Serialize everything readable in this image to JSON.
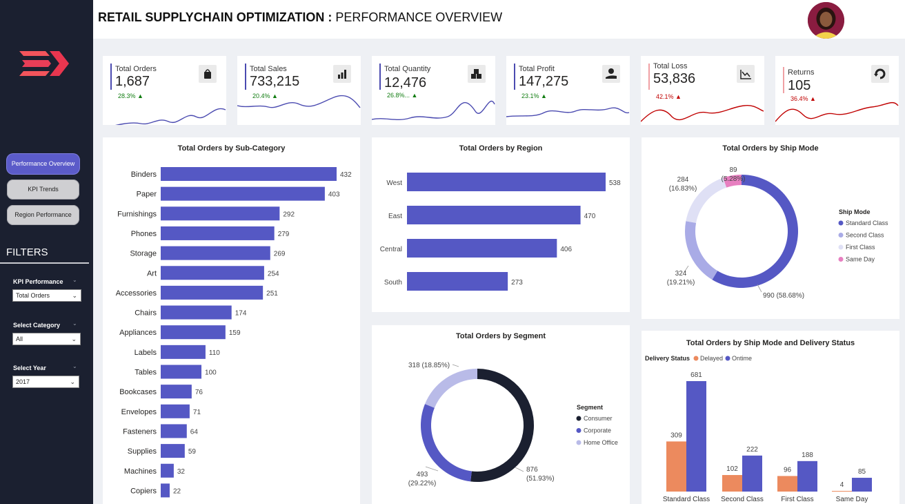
{
  "header": {
    "title_bold": "RETAIL SUPPLYCHAIN OPTIMIZATION :",
    "title_rest": "PERFORMANCE OVERVIEW"
  },
  "nav": {
    "items": [
      {
        "label": "Performance Overview",
        "active": true
      },
      {
        "label": "KPI Trends",
        "active": false
      },
      {
        "label": "Region Performance",
        "active": false
      }
    ]
  },
  "filters": {
    "title": "FILTERS",
    "kpi_performance": {
      "label": "KPI Performance",
      "value": "Total Orders"
    },
    "category": {
      "label": "Select Category",
      "value": "All"
    },
    "year": {
      "label": "Select Year",
      "value": "2017"
    }
  },
  "kpis": [
    {
      "label": "Total Orders",
      "value": "1,687",
      "delta": "28.3%",
      "trend": "up",
      "icon": "shopping-bag-icon",
      "color": "#4a4ab0"
    },
    {
      "label": "Total Sales",
      "value": "733,215",
      "delta": "20.4%",
      "trend": "up",
      "icon": "bar-chart-icon",
      "color": "#4a4ab0"
    },
    {
      "label": "Total Quantity",
      "value": "12,476",
      "delta": "26.8%...",
      "trend": "up",
      "icon": "boxes-icon",
      "color": "#4a4ab0"
    },
    {
      "label": "Total Profit",
      "value": "147,275",
      "delta": "23.1%",
      "trend": "up",
      "icon": "money-hand-icon",
      "color": "#4a4ab0"
    },
    {
      "label": "Total Loss",
      "value": "53,836",
      "delta": "42.1%",
      "trend": "up-bad",
      "icon": "trend-down-icon",
      "color": "#c00000"
    },
    {
      "label": "Returns",
      "value": "105",
      "delta": "36.4%",
      "trend": "up-bad",
      "icon": "return-icon",
      "color": "#c00000"
    }
  ],
  "colors": {
    "primary": "#5558c4",
    "positive": "#107c10",
    "negative": "#c00000",
    "consumer": "#1b2030",
    "corporate": "#5558c4",
    "home_office": "#b9bbe8",
    "standard_class": "#5558c4",
    "second_class": "#a9abe6",
    "first_class": "#dfe0f5",
    "same_day": "#e77fc0",
    "delayed": "#ec8a5e",
    "ontime": "#5558c4"
  },
  "chart_data": [
    {
      "id": "subcategory",
      "type": "bar",
      "orientation": "horizontal",
      "title": "Total Orders by Sub-Category",
      "categories": [
        "Binders",
        "Paper",
        "Furnishings",
        "Phones",
        "Storage",
        "Art",
        "Accessories",
        "Chairs",
        "Appliances",
        "Labels",
        "Tables",
        "Bookcases",
        "Envelopes",
        "Fasteners",
        "Supplies",
        "Machines",
        "Copiers"
      ],
      "values": [
        432,
        403,
        292,
        279,
        269,
        254,
        251,
        174,
        159,
        110,
        100,
        76,
        71,
        64,
        59,
        32,
        22
      ]
    },
    {
      "id": "region",
      "type": "bar",
      "orientation": "horizontal",
      "title": "Total Orders by Region",
      "categories": [
        "West",
        "East",
        "Central",
        "South"
      ],
      "values": [
        538,
        470,
        406,
        273
      ]
    },
    {
      "id": "shipmode",
      "type": "pie",
      "donut": true,
      "title": "Total Orders by Ship Mode",
      "legend_title": "Ship Mode",
      "categories": [
        "Standard Class",
        "Second Class",
        "First Class",
        "Same Day"
      ],
      "values": [
        990,
        324,
        284,
        89
      ],
      "labels": [
        "990 (58.68%)",
        "324\n(19.21%)",
        "284\n(16.83%)",
        "89\n(5.28%)"
      ]
    },
    {
      "id": "segment",
      "type": "pie",
      "donut": true,
      "title": "Total Orders by Segment",
      "legend_title": "Segment",
      "categories": [
        "Consumer",
        "Corporate",
        "Home Office"
      ],
      "values": [
        876,
        493,
        318
      ],
      "labels": [
        "876\n(51.93%)",
        "493\n(29.22%)",
        "318 (18.85%)"
      ]
    },
    {
      "id": "shipstatus",
      "type": "bar",
      "title": "Total Orders by Ship Mode and Delivery Status",
      "legend_title": "Delivery Status",
      "categories": [
        "Standard Class",
        "Second Class",
        "First Class",
        "Same Day"
      ],
      "series": [
        {
          "name": "Delayed",
          "values": [
            309,
            102,
            96,
            4
          ]
        },
        {
          "name": "Ontime",
          "values": [
            681,
            222,
            188,
            85
          ]
        }
      ]
    }
  ]
}
